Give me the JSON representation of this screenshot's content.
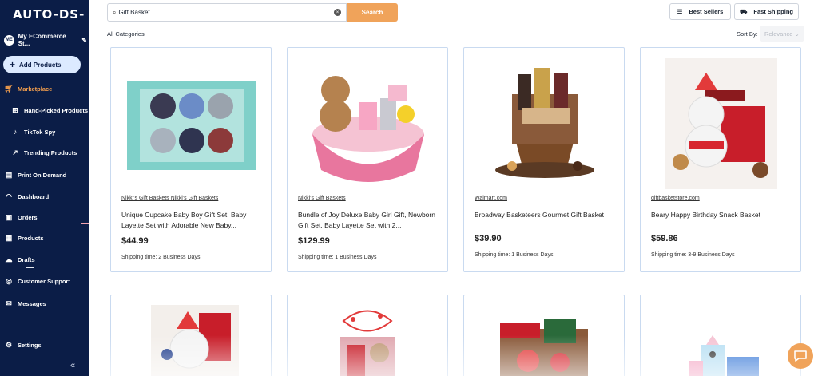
{
  "app": {
    "logo": "AUTO-DS-"
  },
  "store": {
    "initials": "ME",
    "name": "My ECommerce St..."
  },
  "sidebar": {
    "add_products": "Add Products",
    "items": [
      {
        "label": "Marketplace",
        "icon": "cart-icon"
      },
      {
        "label": "Hand-Picked Products",
        "icon": "gift-icon"
      },
      {
        "label": "TikTok Spy",
        "icon": "tiktok-icon"
      },
      {
        "label": "Trending Products",
        "icon": "trend-icon"
      },
      {
        "label": "Print On Demand",
        "icon": "printer-icon"
      },
      {
        "label": "Dashboard",
        "icon": "gauge-icon"
      },
      {
        "label": "Orders",
        "icon": "orders-icon"
      },
      {
        "label": "Products",
        "icon": "box-icon"
      },
      {
        "label": "Drafts",
        "icon": "cloud-icon"
      },
      {
        "label": "Customer Support",
        "icon": "headset-icon"
      },
      {
        "label": "Messages",
        "icon": "mail-icon"
      },
      {
        "label": "Settings",
        "icon": "gear-icon"
      }
    ],
    "collapse": "«"
  },
  "search": {
    "value": "Gift Basket",
    "button": "Search"
  },
  "top_buttons": {
    "best_sellers": "Best Sellers",
    "fast_shipping": "Fast Shipping"
  },
  "filters": {
    "category": "All Categories",
    "sort_label": "Sort By:",
    "sort_value": "Relevance"
  },
  "products": [
    {
      "vendor": "Nikki's Gift Baskets Nikki's Gift Baskets",
      "title": "Unique Cupcake Baby Boy Gift Set, Baby Layette Set with Adorable New Baby...",
      "price": "$44.99",
      "shipping": "Shipping time: 2 Business Days"
    },
    {
      "vendor": "Nikki's Gift Baskets",
      "title": "Bundle of Joy Deluxe Baby Girl Gift, Newborn Gift Set, Baby Layette Set with 2...",
      "price": "$129.99",
      "shipping": "Shipping time: 1 Business Days"
    },
    {
      "vendor": "Walmart.com",
      "title": "Broadway Basketeers Gourmet Gift Basket",
      "price": "$39.90",
      "shipping": "Shipping time: 1 Business Days"
    },
    {
      "vendor": "giftbasketstore.com",
      "title": "Beary Happy Birthday Snack Basket",
      "price": "$59.86",
      "shipping": "Shipping time: 3-9 Business Days"
    }
  ],
  "colors": {
    "sidebar": "#0b1d47",
    "accent": "#f0a35a",
    "card_border": "#c9daf0"
  }
}
